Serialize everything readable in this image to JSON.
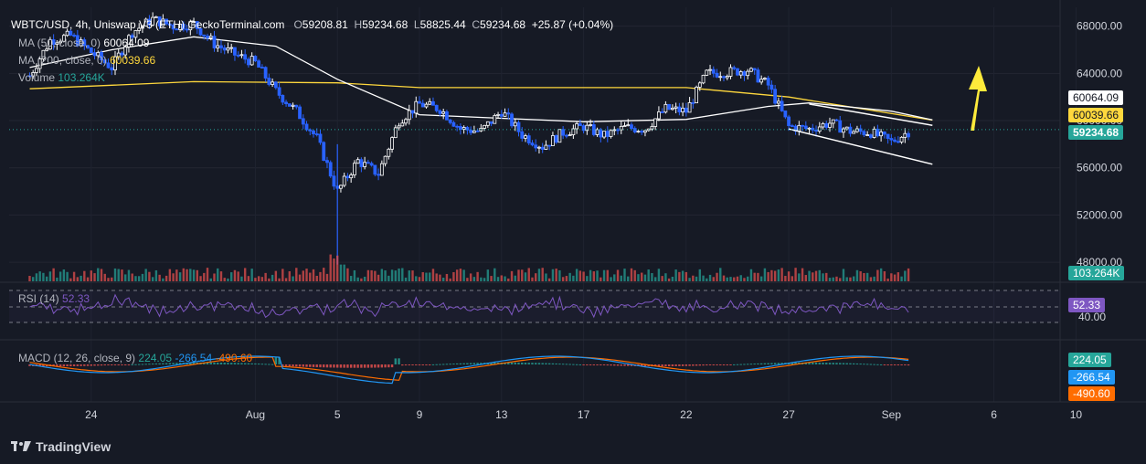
{
  "header": {
    "symbol": "WBTC/USD, 4h, Uniswap V3 (ETH)",
    "source": "GeckoTerminal.com",
    "o_label": "O",
    "o_value": "59208.81",
    "h_label": "H",
    "h_value": "59234.68",
    "l_label": "L",
    "l_value": "58825.44",
    "c_label": "C",
    "c_value": "59234.68",
    "change": "+25.87 (+0.04%)"
  },
  "indicators": {
    "ma50_label": "MA (50, close, 0)",
    "ma50_value": "60064.09",
    "ma200_label": "MA (200, close, 0)",
    "ma200_value": "60039.66",
    "volume_label": "Volume",
    "volume_value": "103.264K",
    "rsi_label": "RSI (14)",
    "rsi_value": "52.33",
    "macd_label": "MACD (12, 26, close, 9)",
    "macd_hist": "224.05",
    "macd_line": "-266.54",
    "macd_signal": "-490.60"
  },
  "price_tags": {
    "ma50": "60064.09",
    "ma200": "60039.66",
    "last": "59234.68",
    "volume": "103.264K",
    "rsi": "52.33",
    "rsi_level": "40.00",
    "macd_hist": "224.05",
    "macd_line": "-266.54",
    "macd_signal": "-490.60"
  },
  "colors": {
    "background": "#161a25",
    "up": "#ffffff",
    "down": "#2962ff",
    "ma50": "#ffffff",
    "ma200": "#ffd83d",
    "rsi": "#7e57c2",
    "macd": "#2196f3",
    "signal": "#ff6d00",
    "vol_up": "#26a69a",
    "vol_down": "#ef5350",
    "arrow": "#ffeb3b"
  },
  "footer": {
    "brand": "TradingView"
  },
  "chart_data": {
    "type": "candlestick",
    "price_axis_ticks": [
      "68000.00",
      "64000.00",
      "60000.00",
      "56000.00",
      "52000.00",
      "48000.00"
    ],
    "date_ticks": [
      "24",
      "Aug",
      "5",
      "9",
      "13",
      "17",
      "22",
      "27",
      "Sep",
      "6",
      "10"
    ],
    "close_path": [
      [
        "Jul 21",
        63800
      ],
      [
        "Jul 22",
        66800
      ],
      [
        "Jul 23",
        67200
      ],
      [
        "Jul 24",
        65800
      ],
      [
        "Jul 25",
        64500
      ],
      [
        "Jul 26",
        67500
      ],
      [
        "Jul 27",
        68600
      ],
      [
        "Jul 28",
        68000
      ],
      [
        "Jul 29",
        68200
      ],
      [
        "Jul 30",
        66500
      ],
      [
        "Jul 31",
        65600
      ],
      [
        "Aug 1",
        64900
      ],
      [
        "Aug 2",
        62500
      ],
      [
        "Aug 3",
        60800
      ],
      [
        "Aug 4",
        58500
      ],
      [
        "Aug 5",
        54000
      ],
      [
        "Aug 6",
        56600
      ],
      [
        "Aug 7",
        55500
      ],
      [
        "Aug 8",
        60000
      ],
      [
        "Aug 9",
        61400
      ],
      [
        "Aug 10",
        61000
      ],
      [
        "Aug 11",
        59300
      ],
      [
        "Aug 12",
        59100
      ],
      [
        "Aug 13",
        60800
      ],
      [
        "Aug 14",
        58800
      ],
      [
        "Aug 15",
        57800
      ],
      [
        "Aug 16",
        59000
      ],
      [
        "Aug 17",
        59500
      ],
      [
        "Aug 18",
        58700
      ],
      [
        "Aug 19",
        59400
      ],
      [
        "Aug 20",
        59300
      ],
      [
        "Aug 21",
        61000
      ],
      [
        "Aug 22",
        60800
      ],
      [
        "Aug 23",
        64000
      ],
      [
        "Aug 24",
        64100
      ],
      [
        "Aug 25",
        64300
      ],
      [
        "Aug 26",
        63000
      ],
      [
        "Aug 27",
        59500
      ],
      [
        "Aug 28",
        59300
      ],
      [
        "Aug 29",
        59800
      ],
      [
        "Aug 30",
        59100
      ],
      [
        "Aug 31",
        59000
      ],
      [
        "Sep 1",
        58200
      ],
      [
        "Sep 2",
        59234.68
      ]
    ],
    "ma50_path": [
      [
        "Jul 21",
        64500
      ],
      [
        "Jul 25",
        66000
      ],
      [
        "Jul 29",
        67100
      ],
      [
        "Aug 2",
        66300
      ],
      [
        "Aug 5",
        63500
      ],
      [
        "Aug 9",
        60500
      ],
      [
        "Aug 13",
        60200
      ],
      [
        "Aug 17",
        59900
      ],
      [
        "Aug 22",
        60100
      ],
      [
        "Aug 26",
        61200
      ],
      [
        "Aug 28",
        61500
      ],
      [
        "Sep 1",
        60800
      ],
      [
        "Sep 3",
        60064.09
      ]
    ],
    "ma200_path": [
      [
        "Jul 21",
        62700
      ],
      [
        "Jul 29",
        63300
      ],
      [
        "Aug 5",
        63200
      ],
      [
        "Aug 9",
        62800
      ],
      [
        "Aug 22",
        62800
      ],
      [
        "Aug 27",
        62000
      ],
      [
        "Sep 3",
        60039.66
      ]
    ],
    "channel_upper": [
      [
        "Aug 28",
        61400
      ],
      [
        "Sep 3",
        59600
      ]
    ],
    "channel_lower": [
      [
        "Aug 27",
        59300
      ],
      [
        "Sep 3",
        56300
      ]
    ],
    "ylim": [
      47000,
      69600
    ],
    "volume_last": "103.264K",
    "rsi_last": 52.33,
    "macd_last": {
      "histogram": 224.05,
      "macd": -266.54,
      "signal": -490.6
    }
  }
}
